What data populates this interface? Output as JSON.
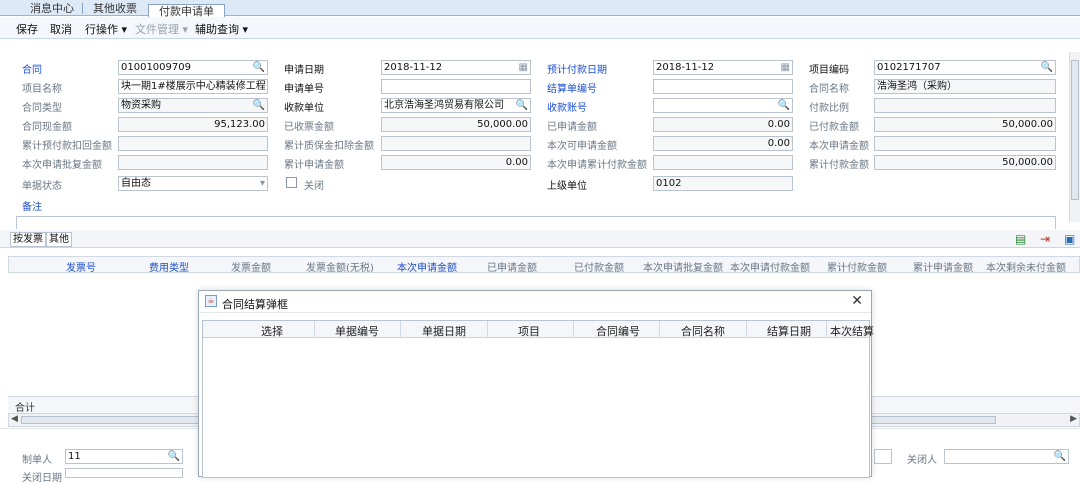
{
  "tabs": {
    "items": [
      "消息中心",
      "其他收票",
      "付款申请单"
    ],
    "active": "付款申请单"
  },
  "toolbar": {
    "save": "保存",
    "cancel": "取消",
    "row_ops": "行操作 ▾",
    "file_mgmt": "文件管理 ▾",
    "aux_query": "辅助查询 ▾"
  },
  "form": {
    "contract_label": "合同",
    "contract_value": "01001009709",
    "apply_date_label": "申请日期",
    "apply_date_value": "2018-11-12",
    "plan_pay_date_label": "预计付款日期",
    "plan_pay_date_value": "2018-11-12",
    "project_code_label": "项目编码",
    "project_code_value": "0102171707",
    "project_name_label": "项目名称",
    "project_name_value": "块一期1#楼展示中心精装修工程",
    "apply_no_label": "申请单号",
    "apply_no_value": "",
    "settle_no_label": "结算单编号",
    "settle_no_value": "",
    "contract_name_label": "合同名称",
    "contract_name_value": "浩海圣鸿（采购）",
    "contract_type_label": "合同类型",
    "contract_type_value": "物资采购",
    "payee_label": "收款单位",
    "payee_value": "北京浩海圣鸿贸易有限公司",
    "payee_account_label": "收款账号",
    "payee_account_value": "",
    "pay_ratio_label": "付款比例",
    "pay_ratio_value": "",
    "contract_amount_label": "合同现金额",
    "contract_amount_value": "95,123.00",
    "invoiced_label": "已收票金额",
    "invoiced_value": "50,000.00",
    "applied_label": "已申请金额",
    "applied_value": "0.00",
    "paid_label": "已付款金额",
    "paid_value": "50,000.00",
    "prepay_deduct_label": "累计预付款扣回金额",
    "prepay_deduct_value": "",
    "deposit_deduct_label": "累计质保金扣除金额",
    "deposit_deduct_value": "",
    "can_apply_label": "本次可申请金额",
    "can_apply_value": "0.00",
    "this_apply_label": "本次申请金额",
    "this_apply_value": "",
    "approve_label": "本次申请批复金额",
    "approve_value": "",
    "cum_apply_label": "累计申请金额",
    "cum_apply_value": "0.00",
    "cum_apply_pay_label": "本次申请累计付款金额",
    "cum_apply_pay_value": "",
    "cum_paid_label": "累计付款金额",
    "cum_paid_value": "50,000.00",
    "status_label": "单据状态",
    "status_value": "自由态",
    "close_label": "关闭",
    "parent_unit_label": "上级单位",
    "parent_unit_value": "0102",
    "remark_label": "备注"
  },
  "subtabs": {
    "invoice": "按发票",
    "other": "其他"
  },
  "grid": {
    "headers": [
      "发票号",
      "费用类型",
      "发票金额",
      "发票金额(无税)",
      "本次申请金额",
      "已申请金额",
      "已付款金额",
      "本次申请批复金额",
      "本次申请付款金额",
      "累计付款金额",
      "累计申请金额",
      "本次剩余未付金额"
    ],
    "sum_label": "合计"
  },
  "bottom": {
    "creator_label": "制单人",
    "creator_value": "11",
    "close_date_label": "关闭日期",
    "closer_label": "关闭人"
  },
  "dialog": {
    "title": "合同结算弹框",
    "headers": [
      "选择",
      "单据编号",
      "单据日期",
      "项目",
      "合同编号",
      "合同名称",
      "结算日期",
      "本次结算"
    ]
  },
  "colors": {
    "required_label": "#1f4fcf",
    "tab_bg": "#dde9f6"
  },
  "icons": [
    "search-icon",
    "calendar-icon",
    "dropdown-icon",
    "close-icon",
    "excel-icon",
    "export-icon",
    "maximize-icon"
  ]
}
